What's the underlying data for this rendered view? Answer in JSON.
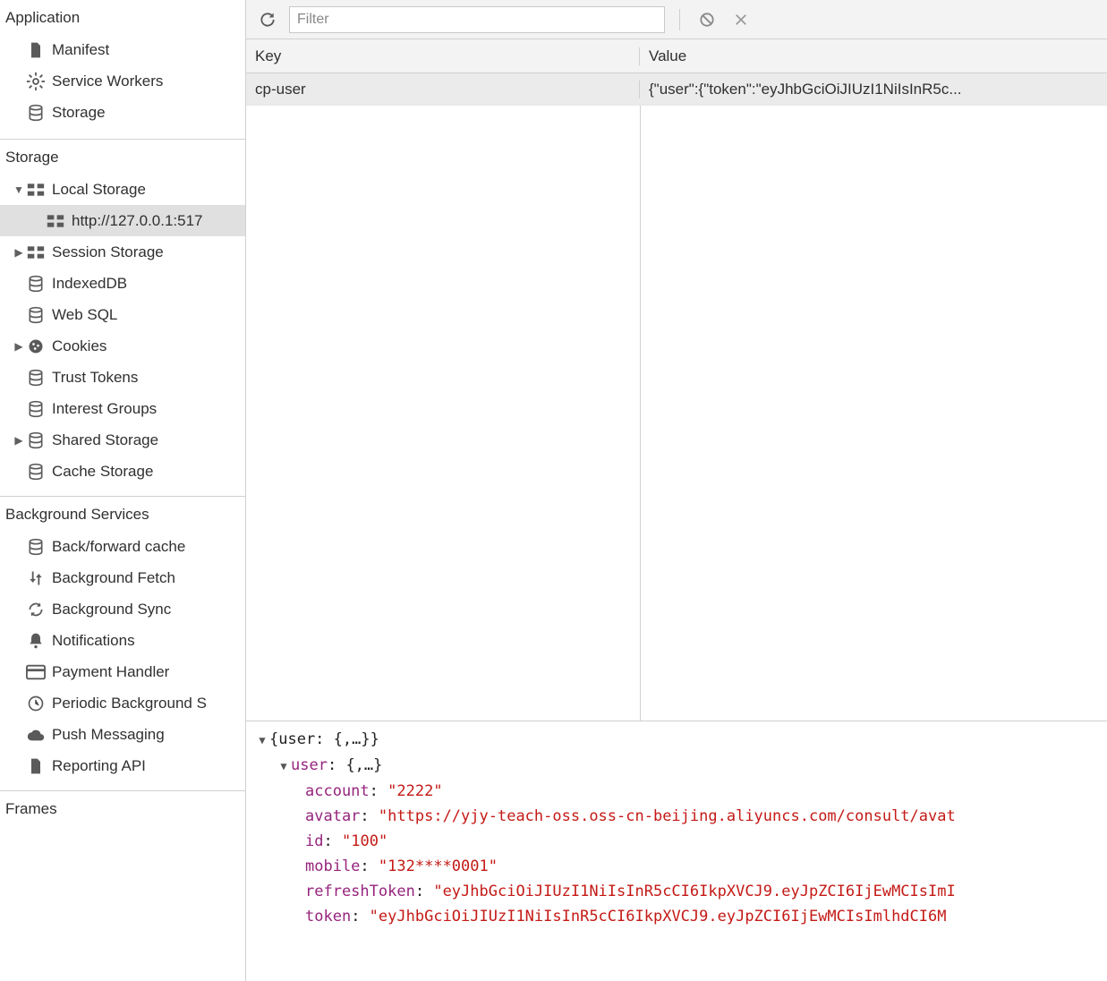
{
  "sidebar": {
    "application": {
      "title": "Application",
      "items": [
        {
          "label": "Manifest",
          "icon": "file"
        },
        {
          "label": "Service Workers",
          "icon": "gear"
        },
        {
          "label": "Storage",
          "icon": "db"
        }
      ]
    },
    "storage": {
      "title": "Storage",
      "items": [
        {
          "label": "Local Storage",
          "icon": "grid",
          "expanded": true,
          "arrow": "down",
          "children": [
            {
              "label": "http://127.0.0.1:517",
              "icon": "grid",
              "selected": true
            }
          ]
        },
        {
          "label": "Session Storage",
          "icon": "grid",
          "arrow": "right"
        },
        {
          "label": "IndexedDB",
          "icon": "db"
        },
        {
          "label": "Web SQL",
          "icon": "db"
        },
        {
          "label": "Cookies",
          "icon": "cookie",
          "arrow": "right"
        },
        {
          "label": "Trust Tokens",
          "icon": "db"
        },
        {
          "label": "Interest Groups",
          "icon": "db"
        },
        {
          "label": "Shared Storage",
          "icon": "db",
          "arrow": "right"
        },
        {
          "label": "Cache Storage",
          "icon": "db"
        }
      ]
    },
    "bgservices": {
      "title": "Background Services",
      "items": [
        {
          "label": "Back/forward cache",
          "icon": "db"
        },
        {
          "label": "Background Fetch",
          "icon": "fetch"
        },
        {
          "label": "Background Sync",
          "icon": "sync"
        },
        {
          "label": "Notifications",
          "icon": "bell"
        },
        {
          "label": "Payment Handler",
          "icon": "card"
        },
        {
          "label": "Periodic Background S",
          "icon": "clock"
        },
        {
          "label": "Push Messaging",
          "icon": "cloud"
        },
        {
          "label": "Reporting API",
          "icon": "file"
        }
      ]
    },
    "frames": {
      "title": "Frames"
    }
  },
  "toolbar": {
    "filter_placeholder": "Filter"
  },
  "table": {
    "headers": {
      "key": "Key",
      "value": "Value"
    },
    "rows": [
      {
        "key": "cp-user",
        "value": "{\"user\":{\"token\":\"eyJhbGciOiJIUzI1NiIsInR5c..."
      }
    ]
  },
  "detail": {
    "root_summary": "{user: {,…}}",
    "user_summary": "user",
    "user_brace": "{,…}",
    "fields": {
      "account": "2222",
      "avatar": "https://yjy-teach-oss.oss-cn-beijing.aliyuncs.com/consult/avat",
      "id": "100",
      "mobile": "132****0001",
      "refreshToken": "eyJhbGciOiJIUzI1NiIsInR5cCI6IkpXVCJ9.eyJpZCI6IjEwMCIsImI",
      "token": "eyJhbGciOiJIUzI1NiIsInR5cCI6IkpXVCJ9.eyJpZCI6IjEwMCIsImlhdCI6M"
    }
  }
}
